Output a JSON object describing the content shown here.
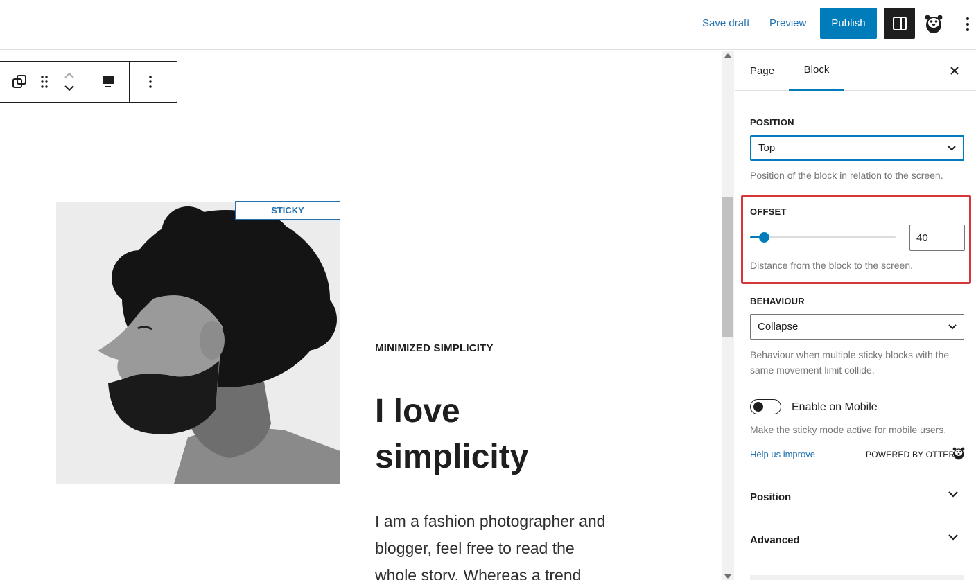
{
  "header": {
    "save_draft_label": "Save draft",
    "preview_label": "Preview",
    "publish_label": "Publish"
  },
  "canvas": {
    "sticky_badge": "STICKY",
    "eyebrow": "MINIMIZED SIMPLICITY",
    "headline_line1": "I love",
    "headline_line2": "simplicity",
    "body_line1": "I am a fashion photographer and",
    "body_line2": "blogger, feel free to read the",
    "body_line3": "whole story. Whereas a trend"
  },
  "sidebar": {
    "tabs": [
      {
        "label": "Page",
        "active": false
      },
      {
        "label": "Block",
        "active": true
      }
    ],
    "position": {
      "label": "POSITION",
      "value": "Top",
      "help": "Position of the block in relation to the screen."
    },
    "offset": {
      "label": "OFFSET",
      "value": "40",
      "slider_fraction": 0.08,
      "help": "Distance from the block to the screen."
    },
    "behaviour": {
      "label": "BEHAVIOUR",
      "value": "Collapse",
      "help_line1": "Behaviour when multiple sticky blocks with the",
      "help_line2": "same movement limit collide."
    },
    "mobile": {
      "label": "Enable on Mobile",
      "enabled": false,
      "help": "Make the sticky mode active for mobile users."
    },
    "footer": {
      "help_link": "Help us improve",
      "powered_by": "POWERED BY OTTER"
    },
    "panels": [
      {
        "title": "Position"
      },
      {
        "title": "Advanced"
      }
    ]
  },
  "colors": {
    "accent": "#007cba",
    "link": "#2271b1",
    "highlight": "#d63638",
    "dark": "#1e1e1e"
  },
  "icons": [
    "settings-sidebar-icon",
    "otter-avatar-icon",
    "more-options-icon",
    "transform-block-icon",
    "drag-handle-icon",
    "move-up-icon",
    "move-down-icon",
    "align-icon",
    "close-icon",
    "chevron-down-icon"
  ]
}
